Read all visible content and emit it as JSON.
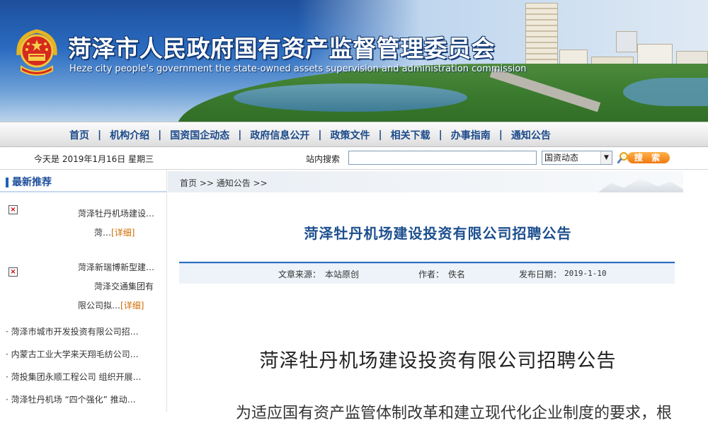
{
  "banner": {
    "title": "菏泽市人民政府国有资产监督管理委员会",
    "subtitle": "Heze city people's government the state-owned assets supervision and administration commission"
  },
  "nav": {
    "items": [
      "首页",
      "机构介绍",
      "国资国企动态",
      "政府信息公开",
      "政策文件",
      "相关下载",
      "办事指南",
      "通知公告"
    ],
    "separator": "|"
  },
  "toolbar": {
    "date": "今天是  2019年1月16日  星期三",
    "search_label": "站内搜索",
    "search_value": "",
    "scope_selected": "国资动态",
    "search_button": "搜 索"
  },
  "sidebar": {
    "heading": "最新推荐",
    "featured": [
      {
        "line1": "菏泽牡丹机场建设…",
        "line2": "菏…",
        "more": "[详细]"
      },
      {
        "line1": "菏泽新瑞博新型建…",
        "line2": "菏泽交通集团有",
        "line3": "限公司拟…",
        "more": "[详细]"
      }
    ],
    "list": [
      "· 菏泽市城市开发投资有限公司招…",
      "· 内蒙古工业大学来天翔毛纺公司…",
      "· 菏投集团永顺工程公司 组织开展…",
      "· 菏泽牡丹机场 “四个强化” 推动…"
    ]
  },
  "article": {
    "breadcrumb": "首页 >> 通知公告 >>",
    "title": "菏泽牡丹机场建设投资有限公司招聘公告",
    "source_label": "文章来源：",
    "source": "本站原创",
    "author_label": "作者：",
    "author": "佚名",
    "date_label": "发布日期：",
    "date": "2019-1-10",
    "doc_title": "菏泽牡丹机场建设投资有限公司招聘公告",
    "body_first_line": "为适应国有资产监管体制改革和建立现代化企业制度的要求，根"
  }
}
